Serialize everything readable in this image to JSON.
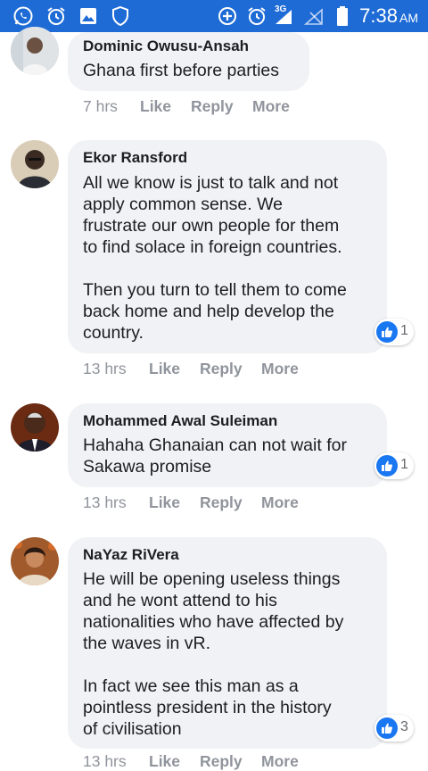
{
  "status_bar": {
    "time": "7:38",
    "ampm": "AM",
    "network": "3G",
    "icons": [
      "whatsapp-icon",
      "alarm-icon",
      "gallery-icon",
      "shield-icon",
      "data-saver-icon",
      "alarm-icon",
      "signal-icon",
      "signal-empty-icon",
      "battery-icon"
    ],
    "background": "#1e6bd6"
  },
  "comments": [
    {
      "author": "Dominic Owusu-Ansah",
      "text": "Ghana first before parties",
      "time": "7 hrs",
      "like_label": "Like",
      "reply_label": "Reply",
      "more_label": "More"
    },
    {
      "author": "Ekor Ransford",
      "text": "All we know is just to talk and not\napply common sense. We\nfrustrate our own people for them\nto find solace in foreign countries.\n\nThen you turn to tell them to come\nback home and help develop the\ncountry.",
      "time": "13 hrs",
      "like_label": "Like",
      "reply_label": "Reply",
      "more_label": "More",
      "reaction_count": "1"
    },
    {
      "author": "Mohammed Awal Suleiman",
      "text": "Hahaha Ghanaian can not wait for\nSakawa promise",
      "time": "13 hrs",
      "like_label": "Like",
      "reply_label": "Reply",
      "more_label": "More",
      "reaction_count": "1"
    },
    {
      "author": "NaYaz RiVera",
      "text": "He will be opening useless things\nand he wont attend to his\nnationalities who have affected by\nthe waves in vR.\n\nIn fact we see this man as a\npointless president in the history\nof civilisation",
      "time": "13 hrs",
      "like_label": "Like",
      "reply_label": "Reply",
      "more_label": "More",
      "reaction_count": "3"
    }
  ],
  "colors": {
    "bubble": "#f0f2f5",
    "meta_text": "#90949c",
    "like_blue": "#1a77f2"
  }
}
